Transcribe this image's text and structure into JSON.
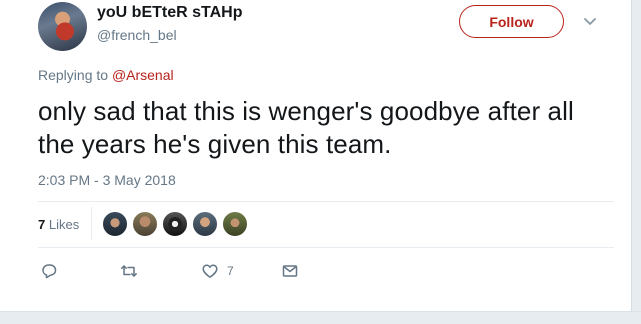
{
  "user": {
    "display_name": "yoU bETteR sTAHp",
    "handle": "@french_bel"
  },
  "follow_button": {
    "label": "Follow"
  },
  "reply_context": {
    "prefix": "Replying to ",
    "mention": "@Arsenal"
  },
  "tweet": {
    "text": "only sad that this is wenger's goodbye after all the years he's given this team.",
    "timestamp": "2:03 PM - 3 May 2018"
  },
  "stats": {
    "likes_count": "7",
    "likes_label": "Likes"
  },
  "likers": [
    "liker-avatar",
    "liker-avatar",
    "liker-avatar",
    "liker-avatar",
    "liker-avatar"
  ],
  "actions": {
    "reply_icon": "reply-icon",
    "retweet_icon": "retweet-icon",
    "like_icon": "heart-icon",
    "like_count": "7",
    "dm_icon": "envelope-icon"
  },
  "colors": {
    "accent": "#b8231c",
    "secondary_text": "#657786",
    "primary_text": "#14171a",
    "divider": "#e6ecf0"
  }
}
